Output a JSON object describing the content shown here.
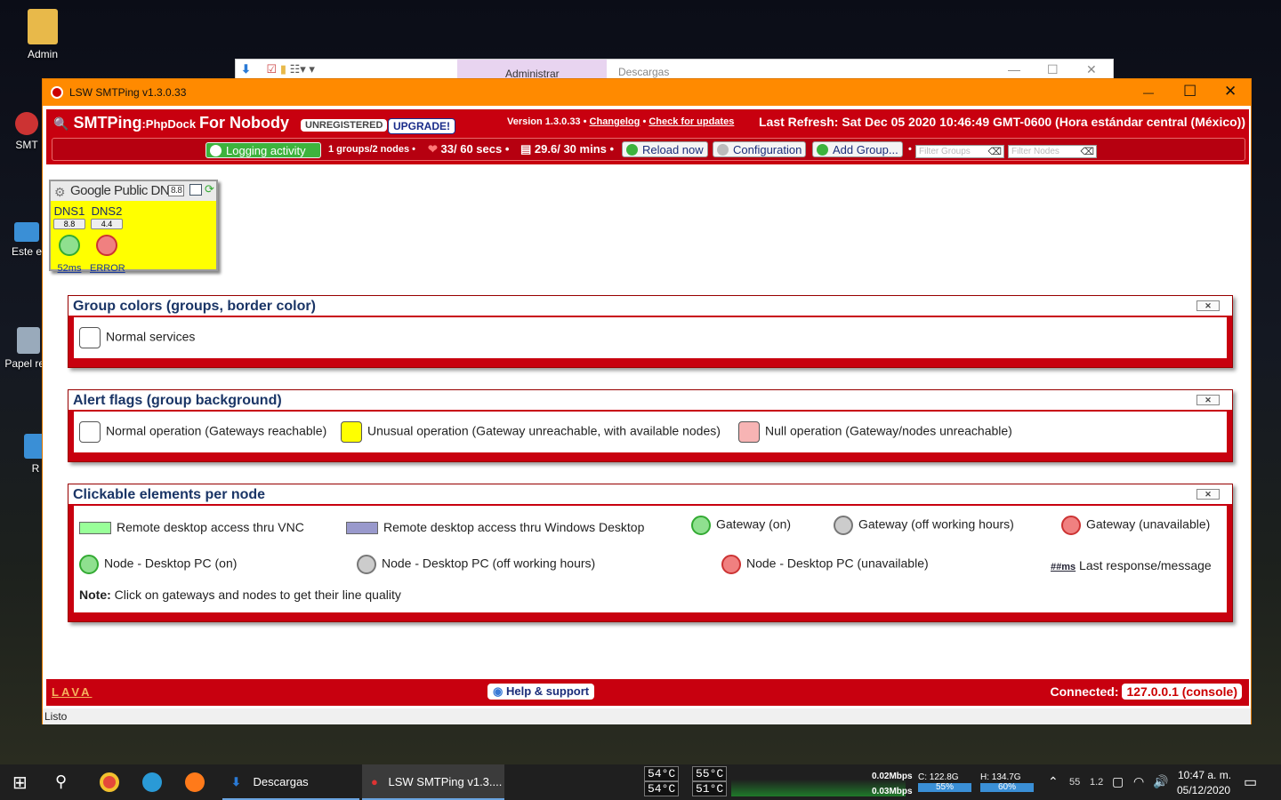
{
  "desktop": {
    "icons": [
      {
        "label": "Admin"
      },
      {
        "label": "SMT"
      },
      {
        "label": "Este e"
      },
      {
        "label": "Papel reci"
      },
      {
        "label": "R"
      }
    ]
  },
  "bg_window": {
    "tab_active": "Administrar",
    "tab_inactive": "Descargas"
  },
  "window": {
    "title": "LSW SMTPing v1.3.0.33",
    "minimize": "—",
    "maximize": "☐",
    "close": "✕"
  },
  "header": {
    "brand": "SMTPing",
    "brand_sub": ":PhpDock",
    "user": "For Nobody",
    "unregistered": "UNREGISTERED",
    "upgrade": "UPGRADE!",
    "version": "Version 1.3.0.33 •",
    "changelog": "Changelog",
    "sep": "•",
    "updates": "Check for updates",
    "last_refresh": "Last Refresh: Sat Dec 05 2020 10:46:49 GMT-0600 (Hora estándar central (México))"
  },
  "toolbar": {
    "logging": "Logging activity",
    "groups_nodes": "1 groups/2 nodes •",
    "ping_interval": "33/ 60 secs •",
    "log_interval": "29.6/ 30 mins •",
    "reload": "Reload now",
    "configuration": "Configuration",
    "add_group": "Add Group...",
    "bullet": "•",
    "filter_groups_placeholder": "Filter Groups",
    "filter_nodes_placeholder": "Filter Nodes"
  },
  "group": {
    "name": "Google Public DNSs",
    "count": "8.8",
    "nodes": [
      {
        "label": "DNS1",
        "ip": "8.8",
        "latency": "52ms",
        "status": "on",
        "color": "#8fe08f"
      },
      {
        "label": "DNS2",
        "ip": "4.4",
        "latency": "ERROR",
        "status": "unavailable",
        "color": "#f08080"
      }
    ]
  },
  "legend": {
    "group_colors": {
      "title": "Group colors (groups, border color)",
      "close": "✕",
      "items": [
        {
          "label": "Normal services",
          "color": "#ffffff"
        }
      ]
    },
    "alert_flags": {
      "title": "Alert flags (group background)",
      "close": "✕",
      "items": [
        {
          "label": "Normal operation (Gateways reachable)",
          "color": "#ffffff"
        },
        {
          "label": "Unusual operation (Gateway unreachable, with available nodes)",
          "color": "#ffff00"
        },
        {
          "label": "Null operation (Gateway/nodes unreachable)",
          "color": "#f7b4b4"
        }
      ]
    },
    "clickable": {
      "title": "Clickable elements per node",
      "close": "✕",
      "vnc": "Remote desktop access thru VNC",
      "rdp": "Remote desktop access thru Windows Desktop",
      "gw_on": "Gateway (on)",
      "gw_off": "Gateway (off working hours)",
      "gw_unavail": "Gateway (unavailable)",
      "node_on": "Node - Desktop PC (on)",
      "node_off": "Node - Desktop PC (off working hours)",
      "node_unavail": "Node - Desktop PC (unavailable)",
      "ms_tag": "##ms",
      "last_response": "Last response/message",
      "note_label": "Note:",
      "note_text": "Click on gateways and nodes to get their line quality"
    }
  },
  "footer": {
    "logo": "LAVA",
    "help": "Help & support",
    "connected_label": "Connected:",
    "connected_value": "127.0.0.1 (console)"
  },
  "statusbar": {
    "text": "Listo"
  },
  "taskbar": {
    "explorer": "Descargas",
    "app": "LSW SMTPing v1.3....",
    "temps": [
      "54°C",
      "55°C",
      "54°C",
      "51°C"
    ],
    "net_up": "0.02Mbps",
    "net_down": "0.03Mbps",
    "disk_c": "C: 122.8G",
    "disk_c_pct": "55%",
    "disk_h": "H: 134.7G",
    "disk_h_pct": "60%",
    "tray_num1": "55",
    "tray_num2": "1.2",
    "time": "10:47 a. m.",
    "date": "05/12/2020"
  }
}
